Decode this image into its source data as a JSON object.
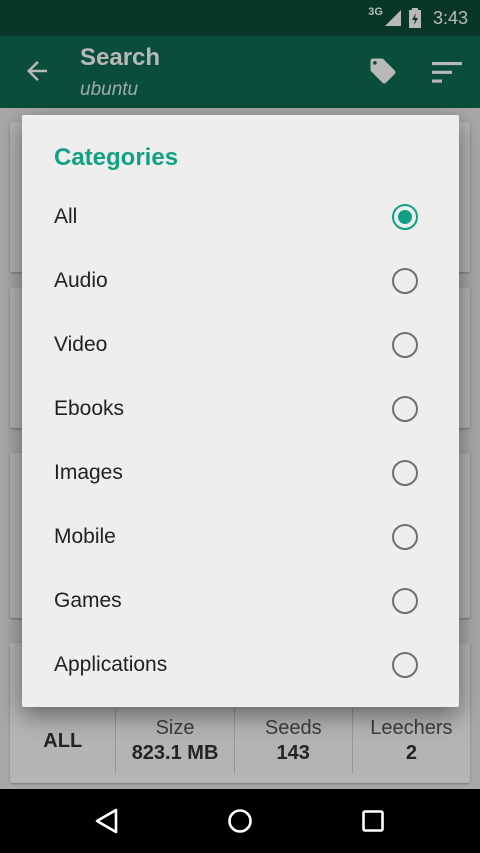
{
  "status_bar": {
    "network": "3G",
    "time": "3:43"
  },
  "toolbar": {
    "title": "Search",
    "subtitle": "ubuntu"
  },
  "background": {
    "stats": {
      "category": "ALL",
      "size_label": "Size",
      "size_value": "823.1 MB",
      "seeds_label": "Seeds",
      "seeds_value": "143",
      "leechers_label": "Leechers",
      "leechers_value": "2"
    }
  },
  "dialog": {
    "title": "Categories",
    "selected": "All",
    "options": [
      {
        "label": "All",
        "checked": true
      },
      {
        "label": "Audio",
        "checked": false
      },
      {
        "label": "Video",
        "checked": false
      },
      {
        "label": "Ebooks",
        "checked": false
      },
      {
        "label": "Images",
        "checked": false
      },
      {
        "label": "Mobile",
        "checked": false
      },
      {
        "label": "Games",
        "checked": false
      },
      {
        "label": "Applications",
        "checked": false
      }
    ]
  },
  "colors": {
    "status_bar": "#0c4b3a",
    "toolbar": "#0f6b52",
    "accent": "#12a085"
  },
  "icons": {
    "back": "arrow-left-icon",
    "tag": "tag-icon",
    "sort": "sort-icon"
  }
}
